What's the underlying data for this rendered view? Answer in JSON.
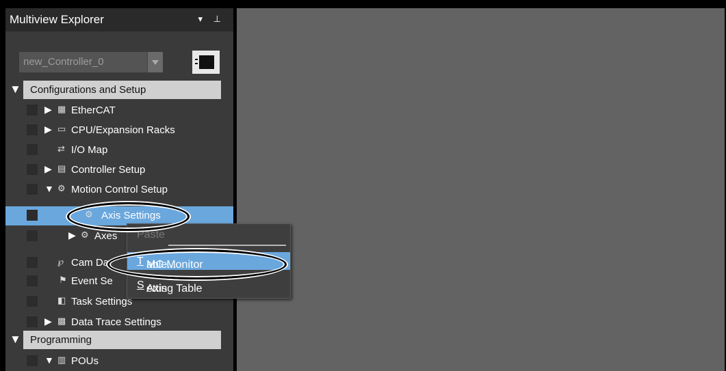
{
  "panel": {
    "title": "Multiview Explorer",
    "controls": "▾ ⊥"
  },
  "controller_dropdown": {
    "value": "new_Controller_0"
  },
  "tree": {
    "section1": "Configurations and Setup",
    "items": [
      {
        "label": "EtherCAT"
      },
      {
        "label": "CPU/Expansion Racks"
      },
      {
        "label": "I/O Map"
      },
      {
        "label": "Controller Setup"
      },
      {
        "label": "Motion Control Setup"
      },
      {
        "label": "Axis Settings"
      },
      {
        "label": "Axes"
      },
      {
        "label": "Cam Da"
      },
      {
        "label": "Event Se"
      },
      {
        "label": "Task Settings"
      },
      {
        "label": "Data Trace Settings"
      }
    ],
    "section2": "Programming",
    "items2": [
      {
        "label": "POUs"
      }
    ]
  },
  "context_menu": {
    "paste": "Paste",
    "item1_pre": "MC Monitor ",
    "item1_u": "T",
    "item1_post": "able...",
    "item2_pre": "Axis ",
    "item2_u": "S",
    "item2_post": "etting Table"
  }
}
